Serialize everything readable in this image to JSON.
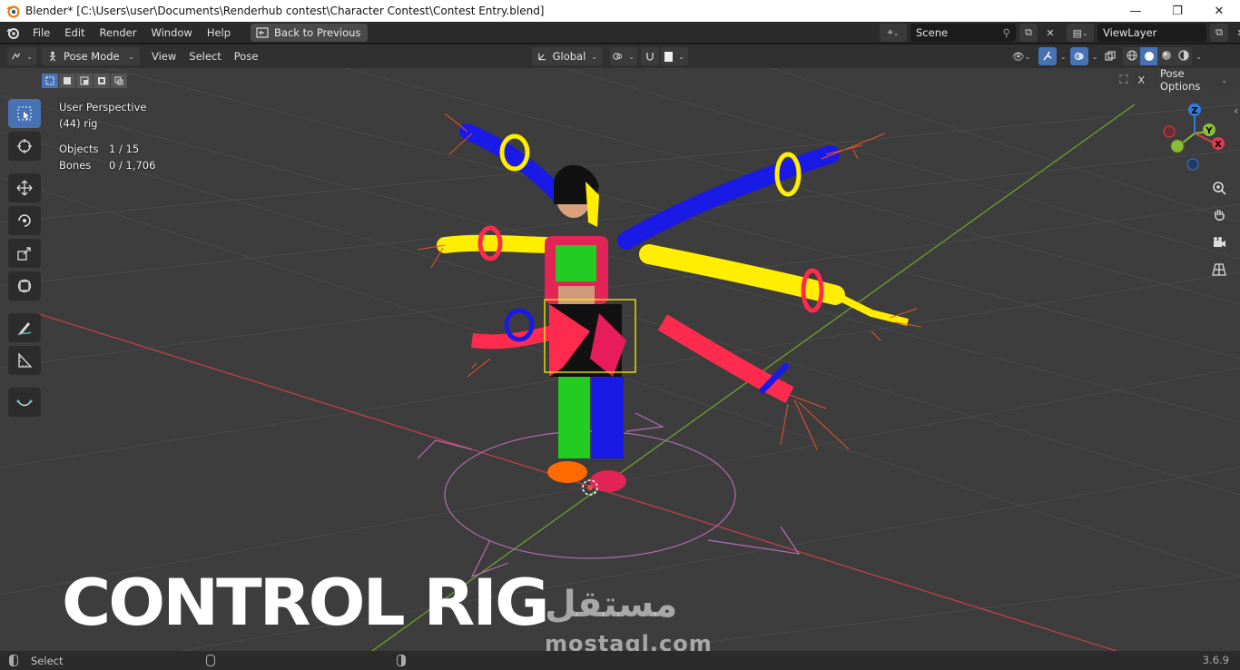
{
  "window": {
    "title": "Blender* [C:\\Users\\user\\Documents\\Renderhub contest\\Character Contest\\Contest Entry.blend]",
    "minimize": "—",
    "maximize": "❐",
    "close": "✕"
  },
  "menu": {
    "items": [
      "File",
      "Edit",
      "Render",
      "Window",
      "Help"
    ],
    "back_label": "Back to Previous"
  },
  "scene": {
    "name": "Scene",
    "view_layer": "ViewLayer"
  },
  "header": {
    "mode": "Pose Mode",
    "menus": [
      "View",
      "Select",
      "Pose"
    ],
    "transform_orientation": "Global",
    "pose_options": "Pose Options"
  },
  "overlay": {
    "perspective": "User Perspective",
    "object_label": "(44) rig",
    "objects_key": "Objects",
    "objects_value": "1 / 15",
    "bones_key": "Bones",
    "bones_value": "0 / 1,706"
  },
  "gizmo": {
    "z": "Z",
    "y": "Y",
    "x": "X"
  },
  "banner": {
    "title": "CONTROL RIG",
    "watermark_ar": "مستقل",
    "watermark": "mostaql.com"
  },
  "status": {
    "select": "Select",
    "version": "3.6.9"
  },
  "colors": {
    "accent": "#4772b3",
    "viewport_bg": "#3d3d3d",
    "ik_yellow": "#ffee00",
    "fk_blue": "#1a1ae6",
    "fk_red": "#ff2b4e",
    "green": "#1dd61d"
  }
}
